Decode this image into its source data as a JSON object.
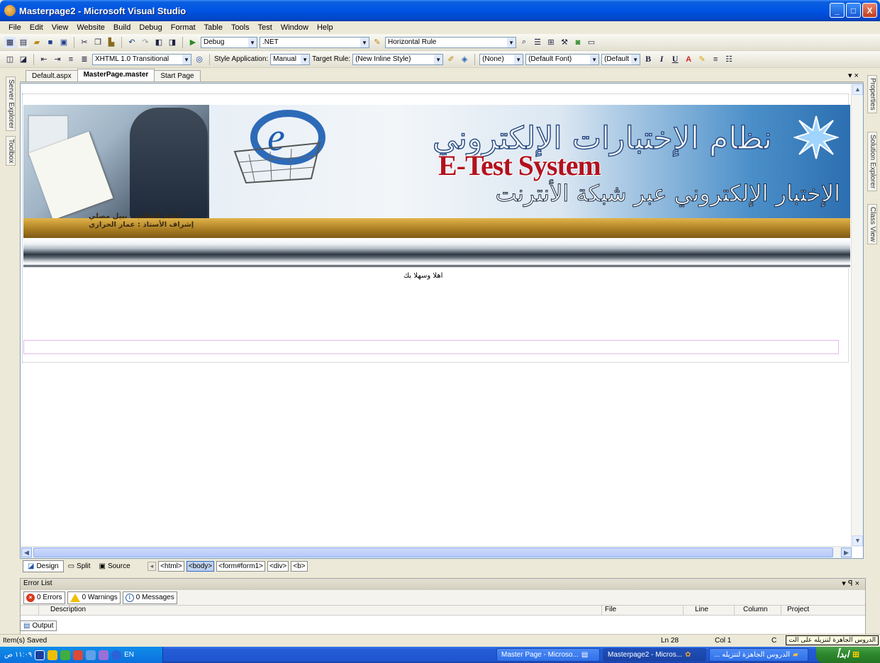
{
  "window": {
    "title": "Masterpage2 - Microsoft Visual Studio",
    "min": "_",
    "max": "□",
    "close": "X"
  },
  "menu": [
    "File",
    "Edit",
    "View",
    "Website",
    "Build",
    "Debug",
    "Format",
    "Table",
    "Tools",
    "Test",
    "Window",
    "Help"
  ],
  "toolbar1": {
    "config": "Debug",
    "platform": ".NET",
    "insert": "Horizontal Rule"
  },
  "toolbar2": {
    "doctype": "XHTML 1.0 Transitional",
    "style_app_label": "Style Application:",
    "style_app_value": "Manual",
    "target_rule_label": "Target Rule:",
    "target_rule_value": "(New Inline Style)",
    "block": "(None)",
    "font": "(Default Font)",
    "size": "(Default",
    "bold": "B",
    "italic": "I",
    "underline": "U"
  },
  "side_left": [
    "Server Explorer",
    "Toolbox"
  ],
  "side_right": [
    "Properties",
    "Solution Explorer",
    "Class View"
  ],
  "doc_tabs": [
    {
      "label": "Default.aspx",
      "active": false
    },
    {
      "label": "MasterPage.master",
      "active": true
    },
    {
      "label": "Start Page",
      "active": false
    }
  ],
  "tab_controls": "▾ ×",
  "banner": {
    "ar_title": "نظام الإختبارات الإلكتروني",
    "en_title": "E-Test System",
    "ar_subtitle": "الإختبار الإلكتروني عبر شبكة الأنترنت",
    "credit_student": "اعداد الطالب : نبيل مصلي",
    "credit_supervisor": "إشراف الأستاذ : عمار الحرازي"
  },
  "welcome": "اهلا وسهلا بك",
  "views": {
    "design": "Design",
    "split": "Split",
    "source": "Source"
  },
  "breadcrumb": [
    "<html>",
    "<body>",
    "<form#form1>",
    "<div>",
    "<b>"
  ],
  "error_list": {
    "title": "Error List",
    "controls": "▾ ꟼ ×",
    "errors": "0 Errors",
    "warnings": "0 Warnings",
    "messages": "0 Messages",
    "columns": [
      "",
      "Description",
      "File",
      "Line",
      "Column",
      "Project"
    ]
  },
  "output_tab": "Output",
  "status": {
    "text": "Item(s) Saved",
    "ln": "Ln 28",
    "col": "Col 1",
    "ch": "C"
  },
  "tooltip": "الدروس الجاهزة لتنزيله على الت",
  "taskbar": {
    "clock": "١١:٠٩ ص",
    "lang": "EN",
    "tasks": [
      "Master Page - Microso...",
      "Masterpage2 - Micros...",
      "الدروس الجاهزة لتنزيله ..."
    ],
    "start": "ابدأ"
  }
}
